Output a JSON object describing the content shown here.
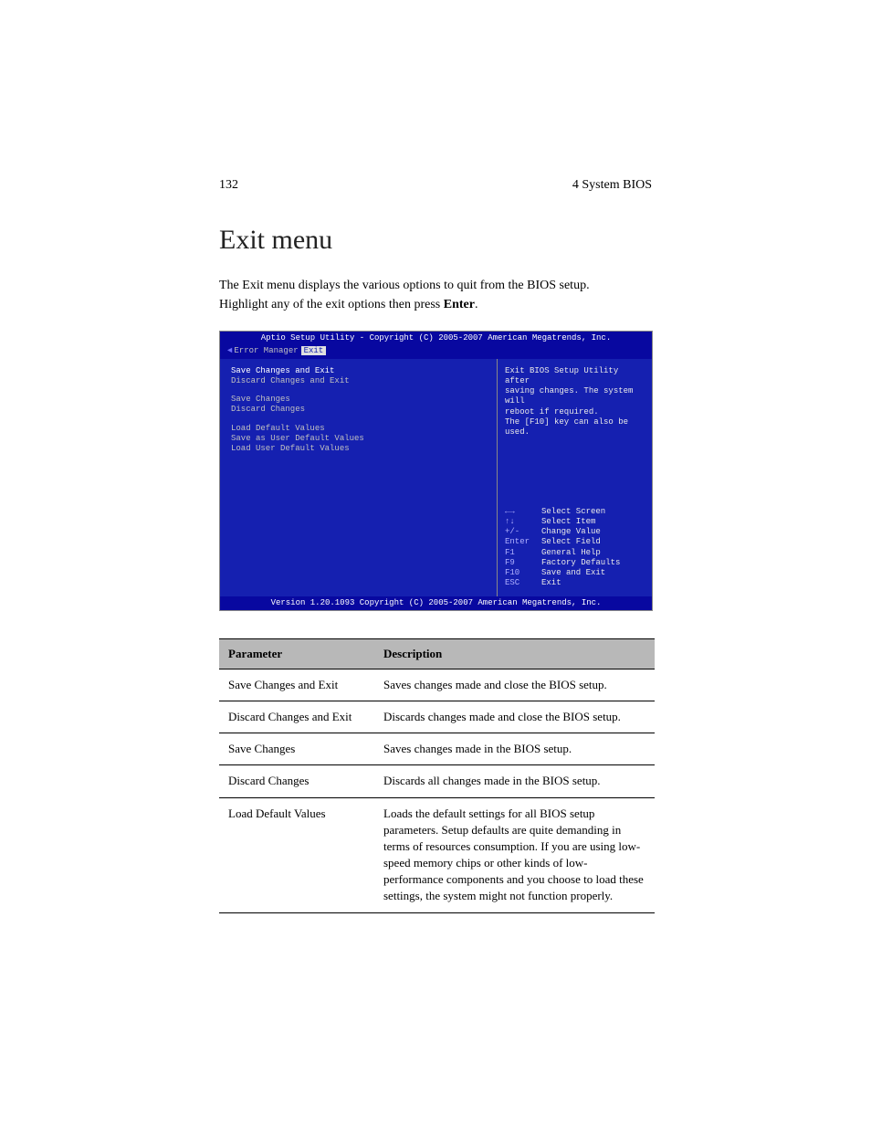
{
  "header": {
    "pageNumber": "132",
    "chapter": "4 System BIOS"
  },
  "title": "Exit menu",
  "intro": {
    "line1": "The Exit menu displays the various options to quit from the BIOS setup.",
    "line2a": "Highlight any of the exit options then press ",
    "line2b": "Enter",
    "line2c": "."
  },
  "bios": {
    "titleBar": "Aptio Setup Utility - Copyright (C) 2005-2007 American Megatrends, Inc.",
    "tabs": {
      "arrow": "◄",
      "inactive": "Error Manager",
      "active": "Exit"
    },
    "menuItems": {
      "i1": "Save Changes and Exit",
      "i2": "Discard Changes and Exit",
      "i3": "Save Changes",
      "i4": "Discard Changes",
      "i5": "Load Default Values",
      "i6": "Save as User Default Values",
      "i7": "Load User Default Values"
    },
    "help": {
      "l1": "Exit BIOS Setup Utility after",
      "l2": "saving changes. The system will",
      "l3": "reboot if required.",
      "l4": "The [F10] key can also be used."
    },
    "keys": [
      {
        "k": "←→",
        "l": "Select Screen"
      },
      {
        "k": "↑↓",
        "l": "Select Item"
      },
      {
        "k": "+/-",
        "l": "Change Value"
      },
      {
        "k": "Enter",
        "l": "Select Field"
      },
      {
        "k": "F1",
        "l": "General Help"
      },
      {
        "k": "F9",
        "l": "Factory Defaults"
      },
      {
        "k": "F10",
        "l": "Save and Exit"
      },
      {
        "k": "ESC",
        "l": "Exit"
      }
    ],
    "footerBar": "Version 1.20.1093 Copyright (C) 2005-2007 American Megatrends, Inc."
  },
  "table": {
    "headers": {
      "param": "Parameter",
      "desc": "Description"
    },
    "rows": [
      {
        "param": "Save Changes and Exit",
        "desc": "Saves changes made and close the BIOS setup."
      },
      {
        "param": "Discard Changes and Exit",
        "desc": "Discards changes made and close the BIOS setup."
      },
      {
        "param": "Save Changes",
        "desc": "Saves changes made in the BIOS setup."
      },
      {
        "param": "Discard Changes",
        "desc": "Discards all changes made in the BIOS setup."
      },
      {
        "param": "Load Default Values",
        "desc": "Loads the default settings for all BIOS setup parameters. Setup defaults are quite demanding in terms of resources consumption. If you are using low-speed memory chips or other kinds of low-performance components and you choose to load these settings, the system might not function properly."
      }
    ]
  }
}
